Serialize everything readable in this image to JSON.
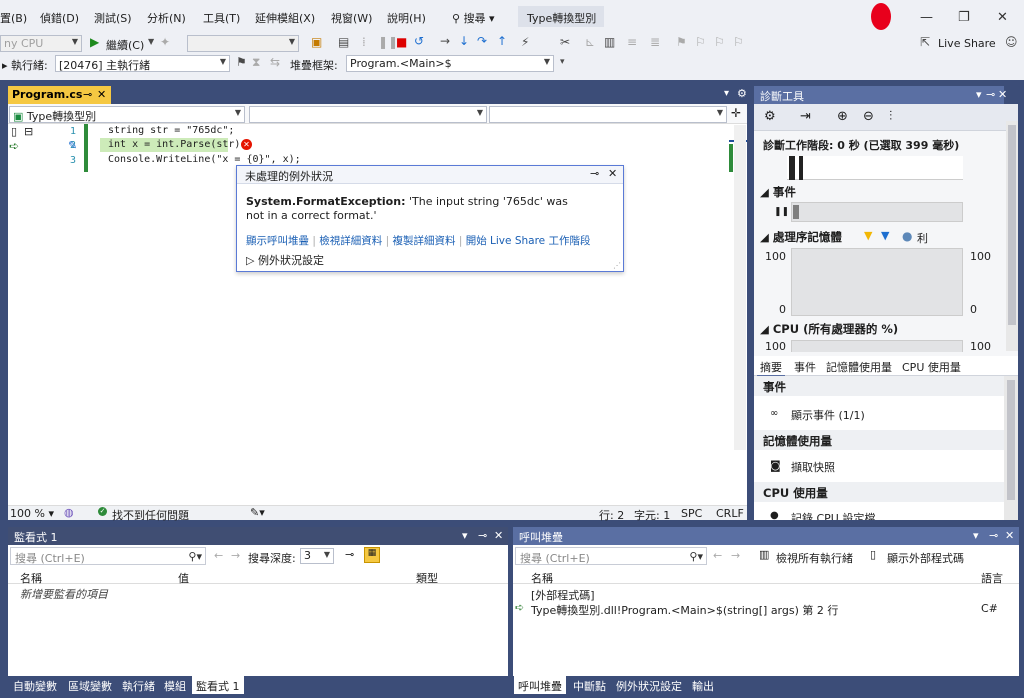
{
  "menu": {
    "items": [
      "置(B)",
      "偵錯(D)",
      "測試(S)",
      "分析(N)",
      "工具(T)",
      "延伸模組(X)",
      "視窗(W)",
      "說明(H)"
    ],
    "search_label": "搜尋",
    "doc_title": "Type轉換型別"
  },
  "toolbar": {
    "cpu_combo": "ny CPU",
    "continue_label": "繼續(C)",
    "live_share": "Live Share",
    "process_label": "執行緒:",
    "thread_value": "[20476] 主執行緒",
    "stack_label": "堆疊框架:",
    "stack_value": "Program.<Main>$"
  },
  "editor": {
    "tab": "Program.cs",
    "nav_left": "Type轉換型別",
    "lines": [
      {
        "num": "1",
        "text": "string str = \"765dc\";"
      },
      {
        "num": "2",
        "text": "int x = int.Parse(str);"
      },
      {
        "num": "3",
        "text": "Console.WriteLine(\"x = {0}\", x);"
      }
    ],
    "zoom": "100 %",
    "status_ok": "找不到任何問題",
    "row": "行: 2",
    "col": "字元: 1",
    "spc": "SPC",
    "crlf": "CRLF"
  },
  "exception": {
    "header": "未處理的例外狀況",
    "type": "System.FormatException:",
    "message": "'The input string '765dc' was not in a correct format.'",
    "links": [
      "顯示呼叫堆疊",
      "檢視詳細資料",
      "複製詳細資料",
      "開始 Live Share 工作階段"
    ],
    "settings": "例外狀況設定"
  },
  "diagnostics": {
    "title": "診斷工具",
    "session": "診斷工作階段: 0 秒 (已選取 399 毫秒)",
    "events": "事件",
    "memory": "處理序記憶體",
    "memory_legend": "利",
    "mem_max_left": "100",
    "mem_max_right": "100",
    "mem_min_left": "0",
    "mem_min_right": "0",
    "cpu": "CPU (所有處理器的 %)",
    "cpu_left": "100",
    "cpu_right": "100",
    "tabs": [
      "摘要",
      "事件",
      "記憶體使用量",
      "CPU 使用量"
    ],
    "sec_events": "事件",
    "show_events": "顯示事件 (1/1)",
    "sec_memory": "記憶體使用量",
    "snapshot": "擷取快照",
    "sec_cpu": "CPU 使用量",
    "record_cpu": "記錄 CPU 設定檔"
  },
  "watch": {
    "title": "監看式 1",
    "search": "搜尋 (Ctrl+E)",
    "depth_label": "搜尋深度:",
    "depth_value": "3",
    "columns": [
      "名稱",
      "值",
      "類型"
    ],
    "placeholder_row": "新增要監看的項目"
  },
  "callstack": {
    "title": "呼叫堆疊",
    "search": "搜尋 (Ctrl+E)",
    "view_threads": "檢視所有執行緒",
    "show_external": "顯示外部程式碼",
    "columns": [
      "名稱",
      "語言"
    ],
    "rows": [
      {
        "name": "[外部程式碼]",
        "lang": ""
      },
      {
        "name": "Type轉換型別.dll!Program.<Main>$(string[] args) 第 2 行",
        "lang": "C#"
      }
    ]
  },
  "bottom_tabs_left": [
    "自動變數",
    "區域變數",
    "執行緒",
    "模組",
    "監看式 1"
  ],
  "bottom_tabs_right": [
    "呼叫堆疊",
    "中斷點",
    "例外狀況設定",
    "輸出"
  ]
}
